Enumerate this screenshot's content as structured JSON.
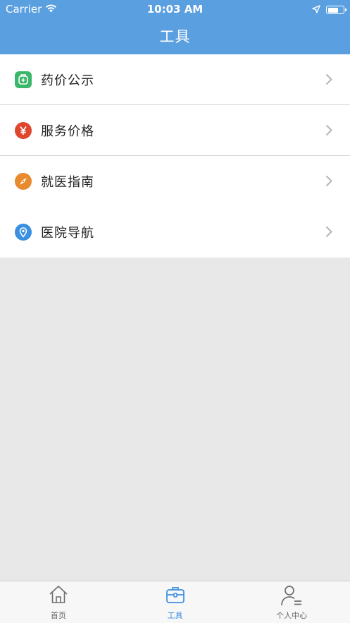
{
  "status_bar": {
    "carrier": "Carrier",
    "time": "10:03 AM"
  },
  "nav": {
    "title": "工具"
  },
  "menu": {
    "items": [
      {
        "label": "药价公示",
        "icon": "medicine-bag-icon",
        "color": "#3cb66a"
      },
      {
        "label": "服务价格",
        "icon": "yen-icon",
        "color": "#e0452d"
      },
      {
        "label": "就医指南",
        "icon": "compass-icon",
        "color": "#e88a2d"
      },
      {
        "label": "医院导航",
        "icon": "location-pin-icon",
        "color": "#3a8fe0"
      }
    ]
  },
  "tabbar": {
    "tabs": [
      {
        "label": "首页",
        "icon": "home-icon",
        "active": false
      },
      {
        "label": "工具",
        "icon": "toolbox-icon",
        "active": true
      },
      {
        "label": "个人中心",
        "icon": "user-icon",
        "active": false
      }
    ]
  },
  "colors": {
    "header": "#5a9fe0",
    "background": "#e8e8e8",
    "active_tab": "#3a8fe0"
  }
}
